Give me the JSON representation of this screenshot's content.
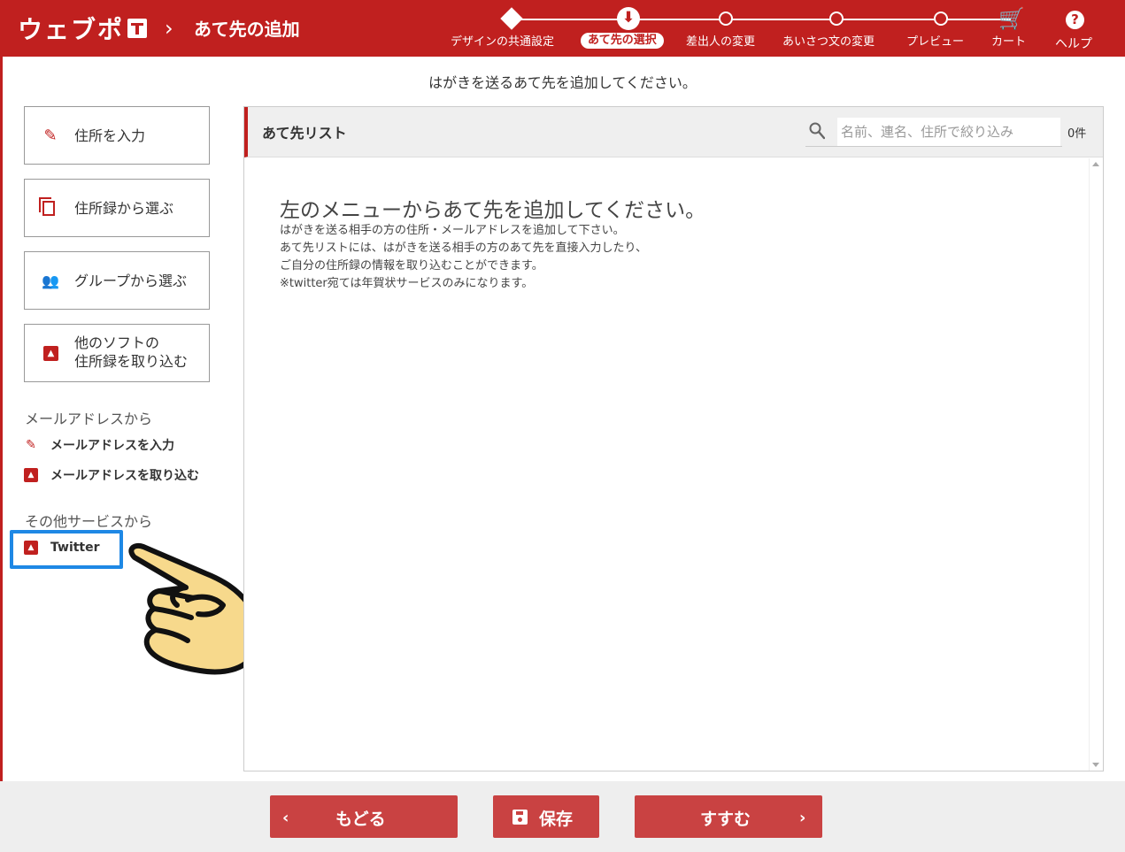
{
  "header": {
    "logo": "ウェブポ",
    "page_title": "あて先の追加",
    "steps": [
      {
        "label": "デザインの共通設定"
      },
      {
        "label": "あて先の選択"
      },
      {
        "label": "差出人の変更"
      },
      {
        "label": "あいさつ文の変更"
      },
      {
        "label": "プレビュー"
      },
      {
        "label": "カート"
      }
    ],
    "help": "ヘルプ"
  },
  "instruction": "はがきを送るあて先を追加してください。",
  "sidebar": {
    "buttons": [
      {
        "label": "住所を入力",
        "icon": "pencil-icon"
      },
      {
        "label": "住所録から選ぶ",
        "icon": "copy-icon"
      },
      {
        "label": "グループから選ぶ",
        "icon": "group-icon"
      },
      {
        "label_line1": "他のソフトの",
        "label_line2": "住所録を取り込む",
        "icon": "import-icon"
      }
    ],
    "mail_section": {
      "title": "メールアドレスから",
      "items": [
        {
          "label": "メールアドレスを入力",
          "icon": "pencil-icon"
        },
        {
          "label": "メールアドレスを取り込む",
          "icon": "import-icon"
        }
      ]
    },
    "other_section": {
      "title": "その他サービスから",
      "items": [
        {
          "label": "Twitter",
          "icon": "import-icon"
        }
      ]
    }
  },
  "panel": {
    "title": "あて先リスト",
    "search_placeholder": "名前、連名、住所で絞り込み",
    "count": "0件",
    "empty_title": "左のメニューからあて先を追加してください。",
    "empty_lines": [
      "はがきを送る相手の方の住所・メールアドレスを追加して下さい。",
      "あて先リストには、はがきを送る相手の方のあて先を直接入力したり、",
      "ご自分の住所録の情報を取り込むことができます。",
      "※twitter宛ては年賀状サービスのみになります。"
    ]
  },
  "footer": {
    "back": "もどる",
    "save": "保存",
    "next": "すすむ"
  },
  "colors": {
    "brand_red": "#c0201f",
    "button_red": "#c94242",
    "highlight_blue": "#1e88e5"
  }
}
